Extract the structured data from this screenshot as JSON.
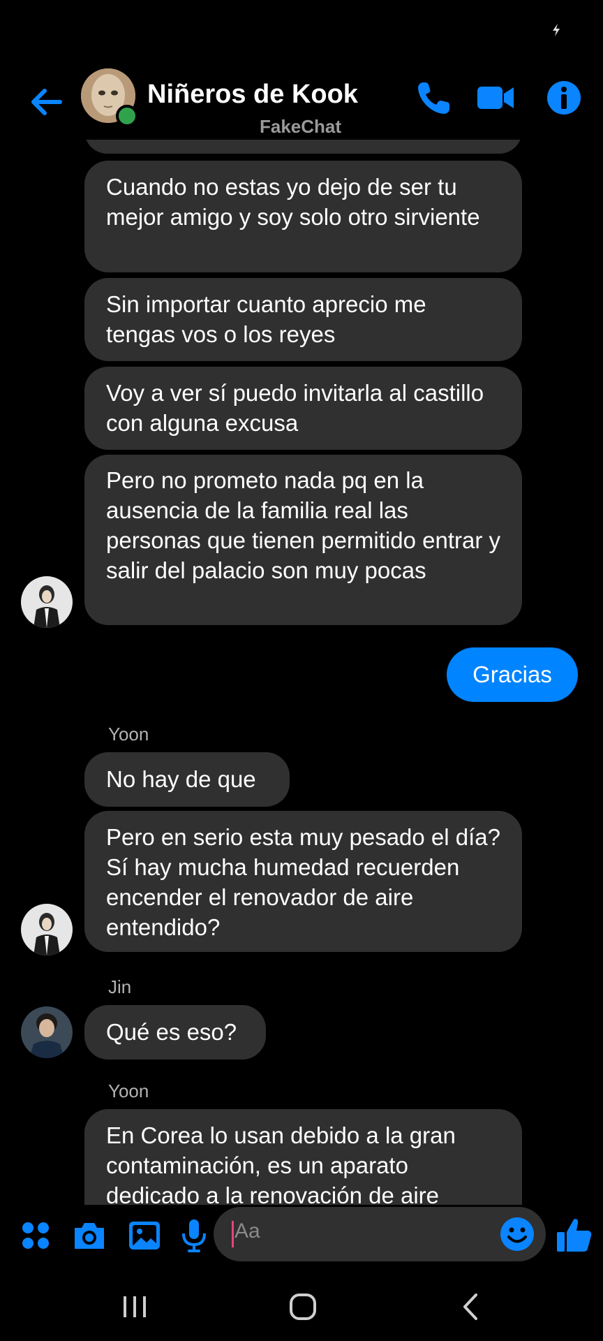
{
  "header": {
    "title": "Niñeros de Kook",
    "subtitle": "FakeChat"
  },
  "messages": [
    {
      "type": "in",
      "text": "Cuando no estas yo dejo de ser tu mejor amigo y soy solo otro sirviente"
    },
    {
      "type": "in",
      "text": "Sin importar cuanto aprecio me tengas vos o los reyes"
    },
    {
      "type": "in",
      "text": "Voy a ver sí puedo invitarla al castillo con alguna excusa"
    },
    {
      "type": "in",
      "text": "Pero no prometo nada pq en la ausencia de la familia real las personas que tienen permitido entrar y salir del palacio son muy pocas"
    },
    {
      "type": "out",
      "text": "Gracias"
    },
    {
      "type": "sender",
      "text": "Yoon"
    },
    {
      "type": "in",
      "text": "No hay de que"
    },
    {
      "type": "in",
      "text": "Pero en serio esta muy pesado el día? Sí hay mucha humedad recuerden encender el renovador de aire entendido?"
    },
    {
      "type": "sender",
      "text": "Jin"
    },
    {
      "type": "in",
      "text": "Qué es eso?"
    },
    {
      "type": "sender",
      "text": "Yoon"
    },
    {
      "type": "in",
      "text": "En Corea lo usan debido a la gran contaminación, es un aparato dedicado a la renovación de aire"
    }
  ],
  "composer": {
    "placeholder": "Aa"
  },
  "colors": {
    "accent": "#0084ff",
    "incoming_bubble": "#303030",
    "background": "#000000",
    "online": "#31a24c"
  },
  "icons": {
    "header": [
      "back-arrow-icon",
      "phone-icon",
      "video-camera-icon",
      "info-icon"
    ],
    "composer": [
      "apps-grid-icon",
      "camera-icon",
      "gallery-icon",
      "microphone-icon",
      "emoji-icon",
      "thumbs-up-icon"
    ],
    "navigation": [
      "recent-apps-icon",
      "home-icon",
      "back-icon"
    ]
  }
}
